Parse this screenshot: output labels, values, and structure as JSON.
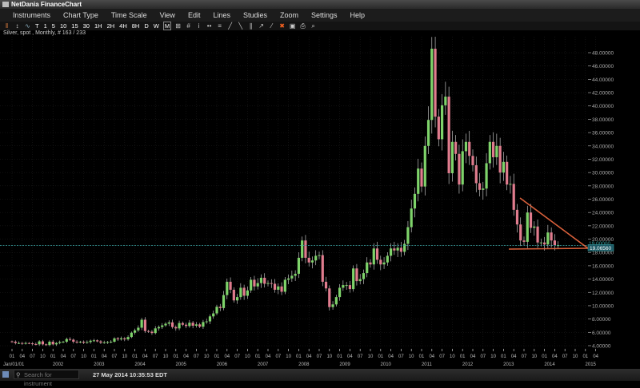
{
  "window": {
    "title": "NetDania FinanceChart"
  },
  "menu": [
    "Instruments",
    "Chart Type",
    "Time Scale",
    "View",
    "Edit",
    "Lines",
    "Studies",
    "Zoom",
    "Settings",
    "Help"
  ],
  "toolbar": {
    "periods": [
      "T",
      "1",
      "5",
      "10",
      "15",
      "30",
      "1H",
      "2H",
      "4H",
      "8H",
      "D",
      "W",
      "M"
    ],
    "selected_period": "M",
    "icons": [
      "candlestick-icon",
      "bar-chart-icon",
      "line-chart-icon",
      "grid-layout-icon",
      "hash-icon",
      "info-icon",
      "compare-icon",
      "volume-icon",
      "draw-line-icon",
      "draw-fibonacci-icon",
      "draw-channel-icon",
      "cursor-icon",
      "trendline-icon",
      "delete-icon",
      "color-icon",
      "print-icon",
      "zoom-icon"
    ]
  },
  "instrument_info": "Silver, spot , Monthly, # 163 / 233",
  "status": {
    "search_placeholder": "Search for instrument",
    "datetime": "27 May 2014 10:35:53 EDT"
  },
  "colors": {
    "up": "#7ed36a",
    "down": "#e07c8e",
    "price_line": "#3aa6a6",
    "trendline": "#d9603b",
    "grid": "#222"
  },
  "chart_data": {
    "type": "candlestick",
    "instrument": "Silver, spot",
    "period": "Monthly",
    "start": "2001-01",
    "ylim": [
      4,
      48
    ],
    "y_ticks": [
      "4.00000",
      "6.00000",
      "8.00000",
      "10.00000",
      "12.00000",
      "14.00000",
      "16.00000",
      "18.00000",
      "20.00000",
      "22.00000",
      "24.00000",
      "26.00000",
      "28.00000",
      "30.00000",
      "32.00000",
      "34.00000",
      "36.00000",
      "38.00000",
      "40.00000",
      "42.00000",
      "44.00000",
      "46.00000",
      "48.00000"
    ],
    "x_month_ticks": [
      "01",
      "04",
      "07",
      "10"
    ],
    "x_year_labels": [
      "Jan/01/01",
      "2002",
      "2003",
      "2004",
      "2005",
      "2006",
      "2007",
      "2008",
      "2009",
      "2010",
      "2011",
      "2012",
      "2013",
      "2014",
      "2015"
    ],
    "closes": [
      4.6,
      4.4,
      4.4,
      4.35,
      4.4,
      4.35,
      4.25,
      4.2,
      4.65,
      4.2,
      4.1,
      4.6,
      4.2,
      4.4,
      4.55,
      4.6,
      5.0,
      4.9,
      4.6,
      4.5,
      4.6,
      4.45,
      4.55,
      4.75,
      4.8,
      4.65,
      4.45,
      4.5,
      4.55,
      4.6,
      5.1,
      4.95,
      5.1,
      4.95,
      5.3,
      5.95,
      6.3,
      6.7,
      7.9,
      6.2,
      6.1,
      5.9,
      6.6,
      6.8,
      7.05,
      7.3,
      7.5,
      6.8,
      6.6,
      7.4,
      7.15,
      6.95,
      7.45,
      7.0,
      7.2,
      6.85,
      7.55,
      7.65,
      8.4,
      8.85,
      9.85,
      9.65,
      11.6,
      13.6,
      12.4,
      10.8,
      11.3,
      12.7,
      11.5,
      12.3,
      13.9,
      12.9,
      13.4,
      14.2,
      13.3,
      13.4,
      13.3,
      12.4,
      12.9,
      12.1,
      13.9,
      14.1,
      14.5,
      14.8,
      17.2,
      19.8,
      17.2,
      16.5,
      16.8,
      17.5,
      17.6,
      13.6,
      12.6,
      9.8,
      10.2,
      11.3,
      12.7,
      13.1,
      13.1,
      12.5,
      15.6,
      13.7,
      14.0,
      14.9,
      16.5,
      16.2,
      18.6,
      16.9,
      16.2,
      16.5,
      17.5,
      18.6,
      18.3,
      18.7,
      18.1,
      19.3,
      21.8,
      24.6,
      26.8,
      30.6,
      27.9,
      34.0,
      37.9,
      48.6,
      38.4,
      35.0,
      40.1,
      41.4,
      29.9,
      34.6,
      32.8,
      28.2,
      33.2,
      34.6,
      32.5,
      31.1,
      28.4,
      27.4,
      27.6,
      31.4,
      34.6,
      32.3,
      34.0,
      30.0,
      31.6,
      28.2,
      28.3,
      24.4,
      22.2,
      19.8,
      19.6,
      24.0,
      21.7,
      21.9,
      19.5,
      19.5,
      19.2,
      21.0,
      19.8,
      19.1,
      19.1
    ],
    "horizontal_line": {
      "value": "19.00000"
    },
    "last_price": "19.06560"
  }
}
